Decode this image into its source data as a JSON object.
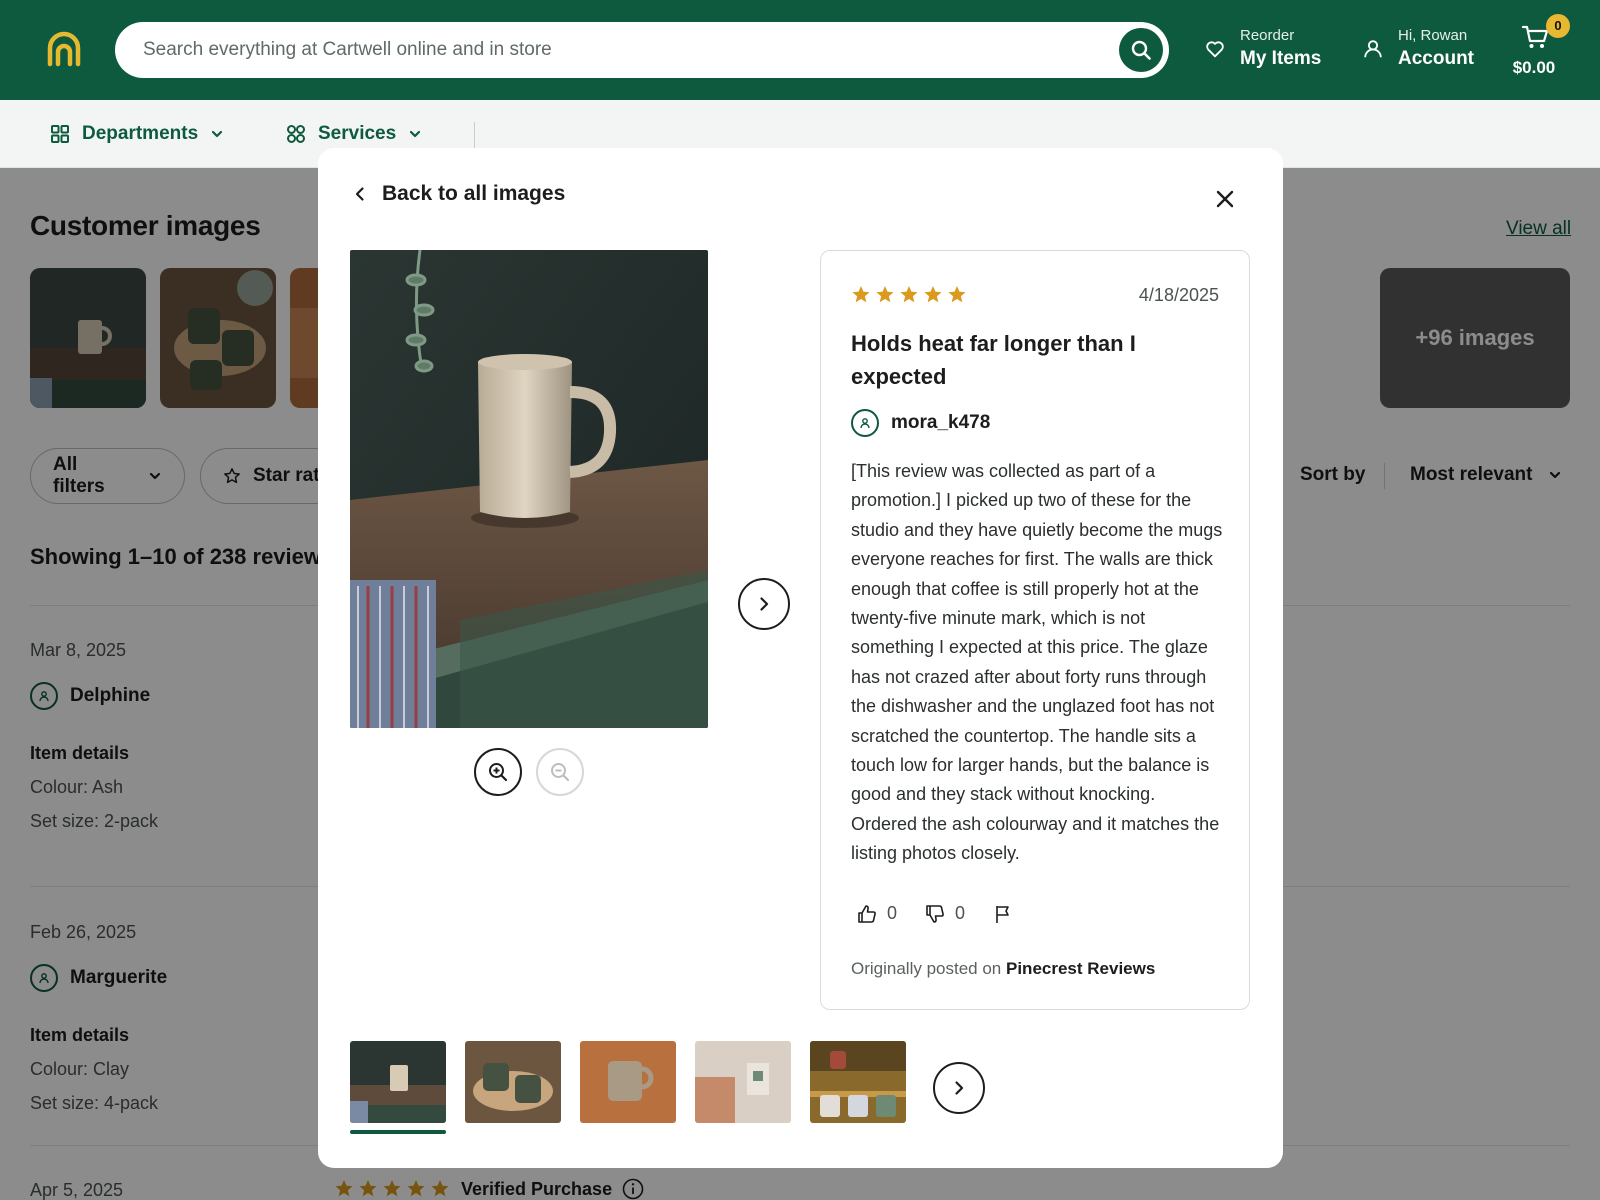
{
  "header": {
    "search_placeholder": "Search everything at Cartwell online and in store",
    "reorder_small": "Reorder",
    "reorder_big": "My Items",
    "account_small": "Hi, Rowan",
    "account_big": "Account",
    "cart_count": "0",
    "cart_total": "$0.00"
  },
  "subnav": {
    "departments": "Departments",
    "services": "Services"
  },
  "page": {
    "title": "Customer images",
    "view_all": "View all",
    "more_images": "+96 images",
    "filters": {
      "all_filters": "All filters",
      "star_rating": "Star rat"
    },
    "sort_label": "Sort by",
    "sort_value": "Most relevant",
    "showing": "Showing 1–10 of 238 reviews",
    "reviews": [
      {
        "date": "Mar 8, 2025",
        "user": "Delphine",
        "details_label": "Item details",
        "colour": "Colour: Ash",
        "set_size": "Set size: 2-pack"
      },
      {
        "date": "Feb 26, 2025",
        "user": "Marguerite",
        "details_label": "Item details",
        "colour": "Colour: Clay",
        "set_size": "Set size: 4-pack"
      },
      {
        "date": "Apr 5, 2025",
        "verified": "Verified Purchase"
      }
    ]
  },
  "modal": {
    "back_label": "Back to all images",
    "review": {
      "rating": 5,
      "date": "4/18/2025",
      "title": "Holds heat far longer than I expected",
      "user": "mora_k478",
      "body": "[This review was collected as part of a promotion.] I picked up two of these for the studio and they have quietly become the mugs everyone reaches for first. The walls are thick enough that coffee is still properly hot at the twenty-five minute mark, which is not something I expected at this price. The glaze has not crazed after about forty runs through the dishwasher and the unglazed foot has not scratched the countertop. The handle sits a touch low for larger hands, but the balance is good and they stack without knocking. Ordered the ash colourway and it matches the listing photos closely.",
      "helpful_count": "0",
      "unhelpful_count": "0",
      "originally_posted": "Originally posted on",
      "source": "Pinecrest Reviews"
    }
  },
  "colors": {
    "brand_green": "#0d5a3f",
    "star_gold": "#d99a1e",
    "badge_yellow": "#e8b830"
  }
}
